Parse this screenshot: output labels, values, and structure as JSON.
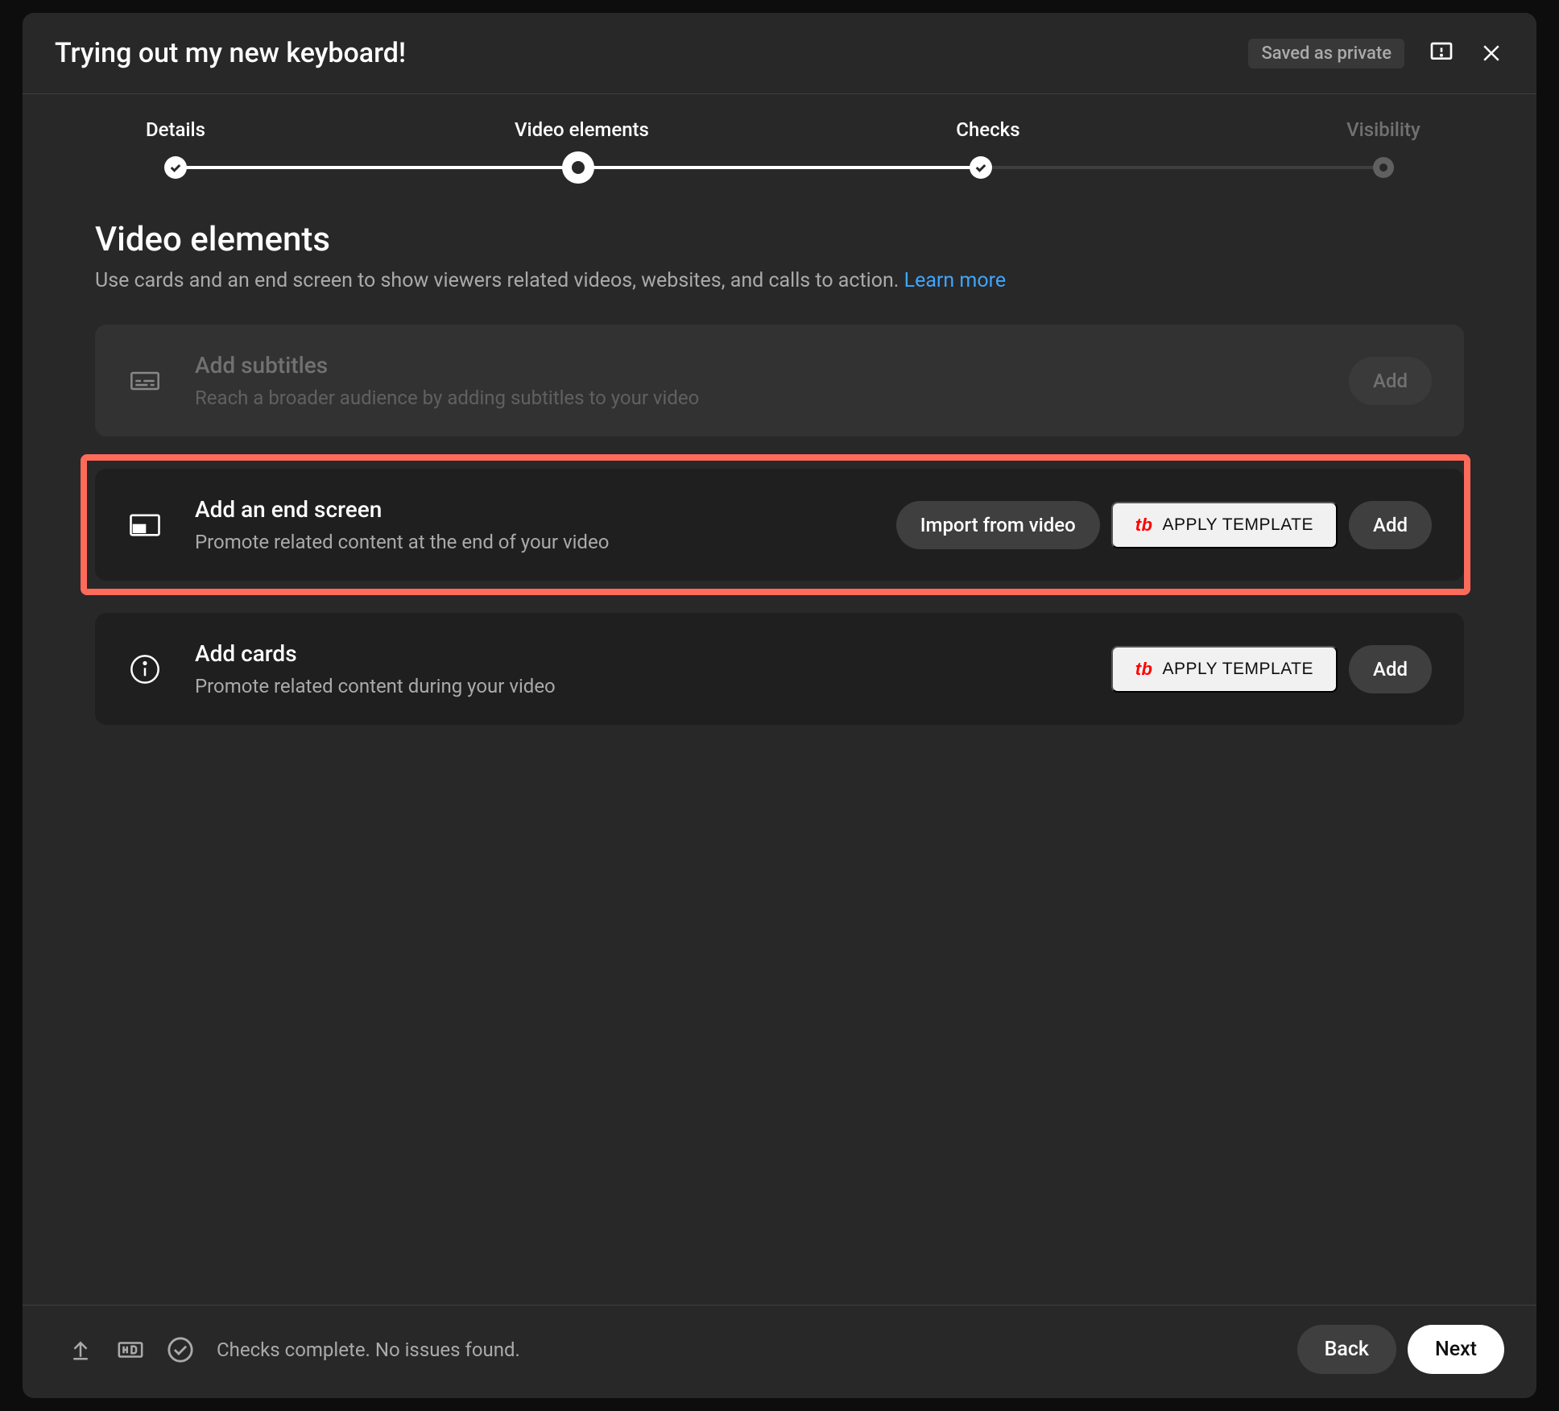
{
  "header": {
    "title": "Trying out my new keyboard!",
    "saved_badge": "Saved as private"
  },
  "stepper": {
    "steps": [
      {
        "label": "Details",
        "state": "done"
      },
      {
        "label": "Video elements",
        "state": "current"
      },
      {
        "label": "Checks",
        "state": "done"
      },
      {
        "label": "Visibility",
        "state": "inactive"
      }
    ]
  },
  "page": {
    "title": "Video elements",
    "description_prefix": "Use cards and an end screen to show viewers related videos, websites, and calls to action. ",
    "learn_more": "Learn more"
  },
  "cards": {
    "subtitles": {
      "title": "Add subtitles",
      "description": "Reach a broader audience by adding subtitles to your video",
      "add_button": "Add"
    },
    "end_screen": {
      "title": "Add an end screen",
      "description": "Promote related content at the end of your video",
      "import_button": "Import from video",
      "template_button": "APPLY TEMPLATE",
      "add_button": "Add"
    },
    "info_cards": {
      "title": "Add cards",
      "description": "Promote related content during your video",
      "template_button": "APPLY TEMPLATE",
      "add_button": "Add"
    }
  },
  "footer": {
    "status": "Checks complete. No issues found.",
    "back_button": "Back",
    "next_button": "Next"
  }
}
